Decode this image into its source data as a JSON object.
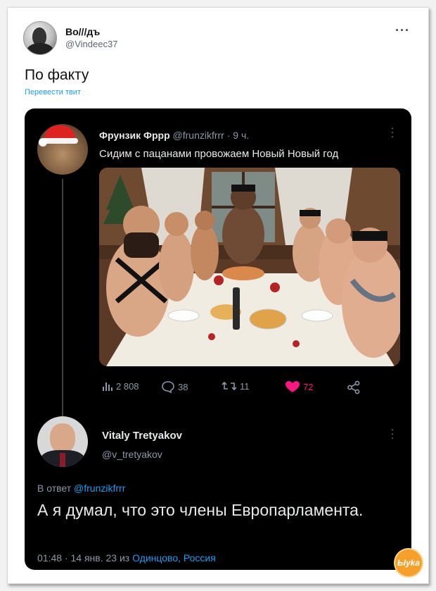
{
  "outer_tweet": {
    "author_name": "Во///дъ",
    "author_handle": "@Vindeec37",
    "more_icon": "more-horizontal-icon",
    "text": "По факту",
    "translate_label": "Перевести твит"
  },
  "quoted_tweet": {
    "author_name": "Фрунзик Фррр",
    "author_handle": "@frunzikfrrr",
    "separator": "·",
    "time_ago": "9 ч.",
    "text": "Сидим с пацанами провожаем Новый Новый год",
    "stats": {
      "views": "2 808",
      "replies": "38",
      "retweets": "11",
      "likes": "72"
    },
    "icons": {
      "views": "bar-chart-icon",
      "replies": "speech-bubble-icon",
      "retweets": "retweet-icon",
      "likes": "heart-icon",
      "share": "share-icon",
      "more": "more-vertical-icon"
    }
  },
  "reply_tweet": {
    "author_name": "Vitaly Tretyakov",
    "author_handle": "@v_tretyakov",
    "replying_prefix": "В ответ",
    "replying_to": "@frunzikfrrr",
    "text": "А я думал, что это члены Европарламента.",
    "time": "01:48",
    "date": "14 янв. 23",
    "from_word": "из",
    "location": "Одинцово, Россия",
    "separator": "·"
  },
  "watermark": {
    "text": "Ыyka"
  },
  "colors": {
    "card_background": "#ffffff",
    "dark_background": "#000000",
    "accent_blue": "#1d9bf0",
    "like_pink": "#f91880",
    "secondary_text": "#8b98a5"
  }
}
